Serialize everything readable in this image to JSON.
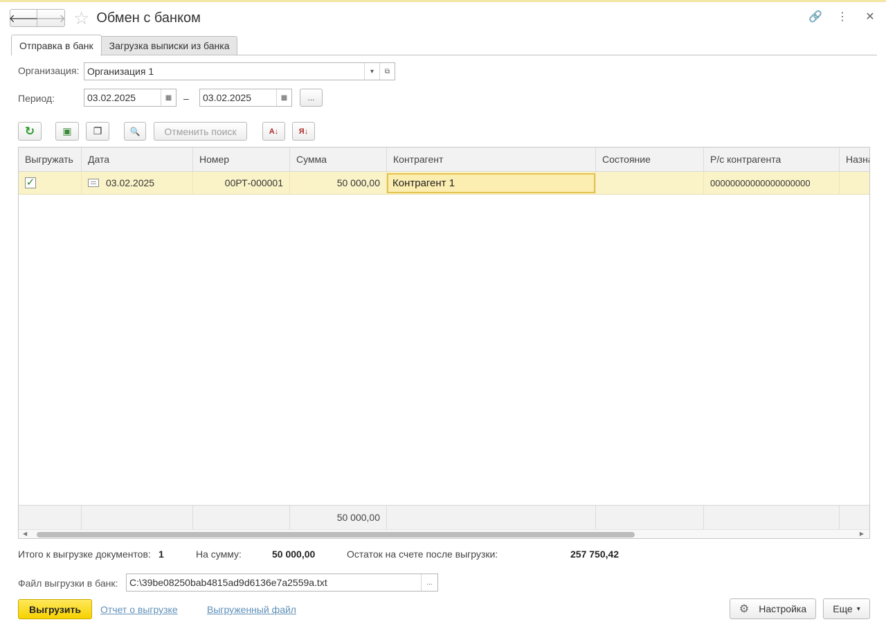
{
  "window": {
    "title": "Обмен с банком"
  },
  "nav": {
    "back": "🡐",
    "forward": "🡒",
    "star": "☆"
  },
  "title_actions": {
    "link": "🔗",
    "menu": "⋮",
    "close": "✕"
  },
  "tabs": [
    {
      "label": "Отправка в банк",
      "active": true
    },
    {
      "label": "Загрузка выписки из банка",
      "active": false
    }
  ],
  "form": {
    "org_label": "Организация:",
    "org_value": "Организация 1",
    "period_label": "Период:",
    "date_from": "03.02.2025",
    "date_sep": "–",
    "date_to": "03.02.2025",
    "period_btn": "..."
  },
  "toolbar": {
    "refresh_icon": "↻",
    "check_all_icon": "▣",
    "uncheck_all_icon": "❐",
    "search_icon": "🔍",
    "cancel_search": "Отменить поиск",
    "sort_asc_icon": "А↓",
    "sort_desc_icon": "Я↓"
  },
  "table": {
    "columns": [
      "Выгружать",
      "Дата",
      "Номер",
      "Сумма",
      "Контрагент",
      "Состояние",
      "Р/с контрагента",
      "Назна"
    ],
    "rows": [
      {
        "checked": "✓",
        "date": "03.02.2025",
        "number": "00РТ-000001",
        "amount": "50 000,00",
        "counterparty": "Контрагент 1",
        "state": "",
        "account": "00000000000000000000"
      }
    ],
    "footer_amount": "50 000,00"
  },
  "summary": {
    "docs_label": "Итого к выгрузке документов:",
    "docs_value": "1",
    "sum_label": "На сумму:",
    "sum_value": "50 000,00",
    "balance_label": "Остаток на счете после выгрузки:",
    "balance_value": "257 750,42"
  },
  "file": {
    "label": "Файл выгрузки в банк:",
    "value": "C:\\39be08250bab4815ad9d6136e7a2559a.txt",
    "btn": "..."
  },
  "bottom": {
    "export_btn": "Выгрузить",
    "report_link": "Отчет о выгрузке",
    "file_link": "Выгруженный файл",
    "settings_icon": "⚙",
    "settings_btn": "Настройка",
    "more_btn": "Еще",
    "more_arrow": "▾"
  }
}
